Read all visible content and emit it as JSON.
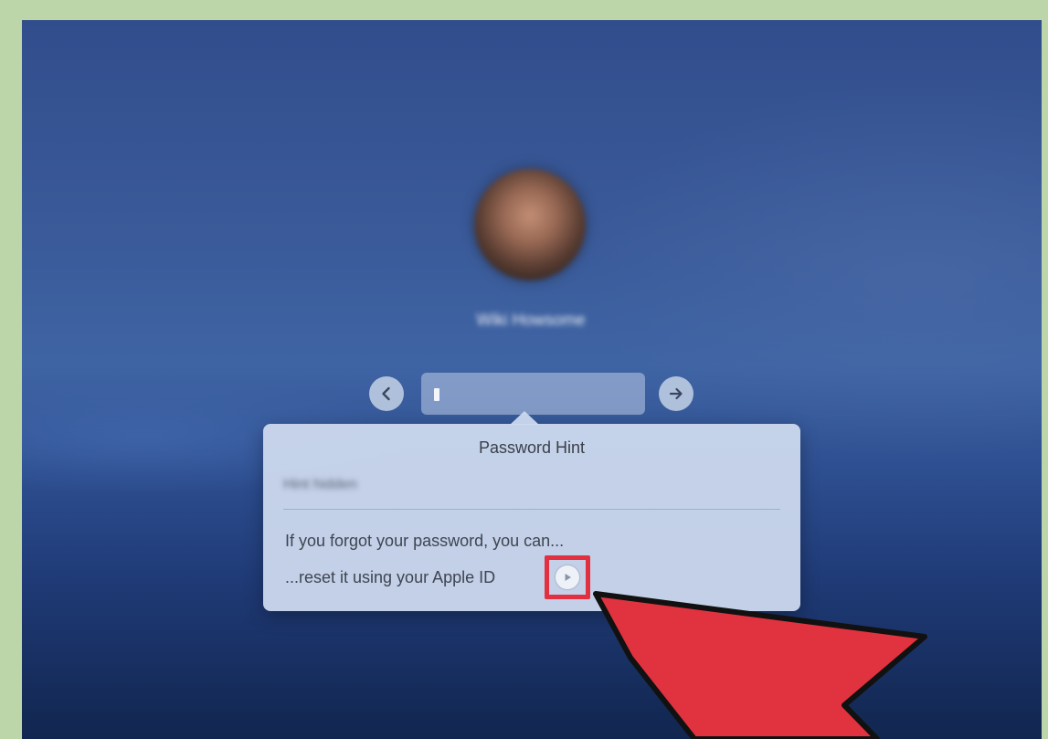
{
  "user": {
    "name": "Wiki Howsome",
    "avatar_icon": "user-photo"
  },
  "password_field": {
    "value": "•"
  },
  "buttons": {
    "back_icon": "chevron-left-icon",
    "submit_icon": "arrow-right-icon",
    "reset_icon": "play-circle-icon"
  },
  "popover": {
    "title": "Password Hint",
    "hint": "Hint hidden",
    "forgot_text": "If you forgot your password, you can...",
    "reset_text": "...reset it using your Apple ID"
  },
  "colors": {
    "highlight": "#e23040",
    "annotation_arrow": "#e0323f",
    "frame": "#bcd6a9"
  }
}
